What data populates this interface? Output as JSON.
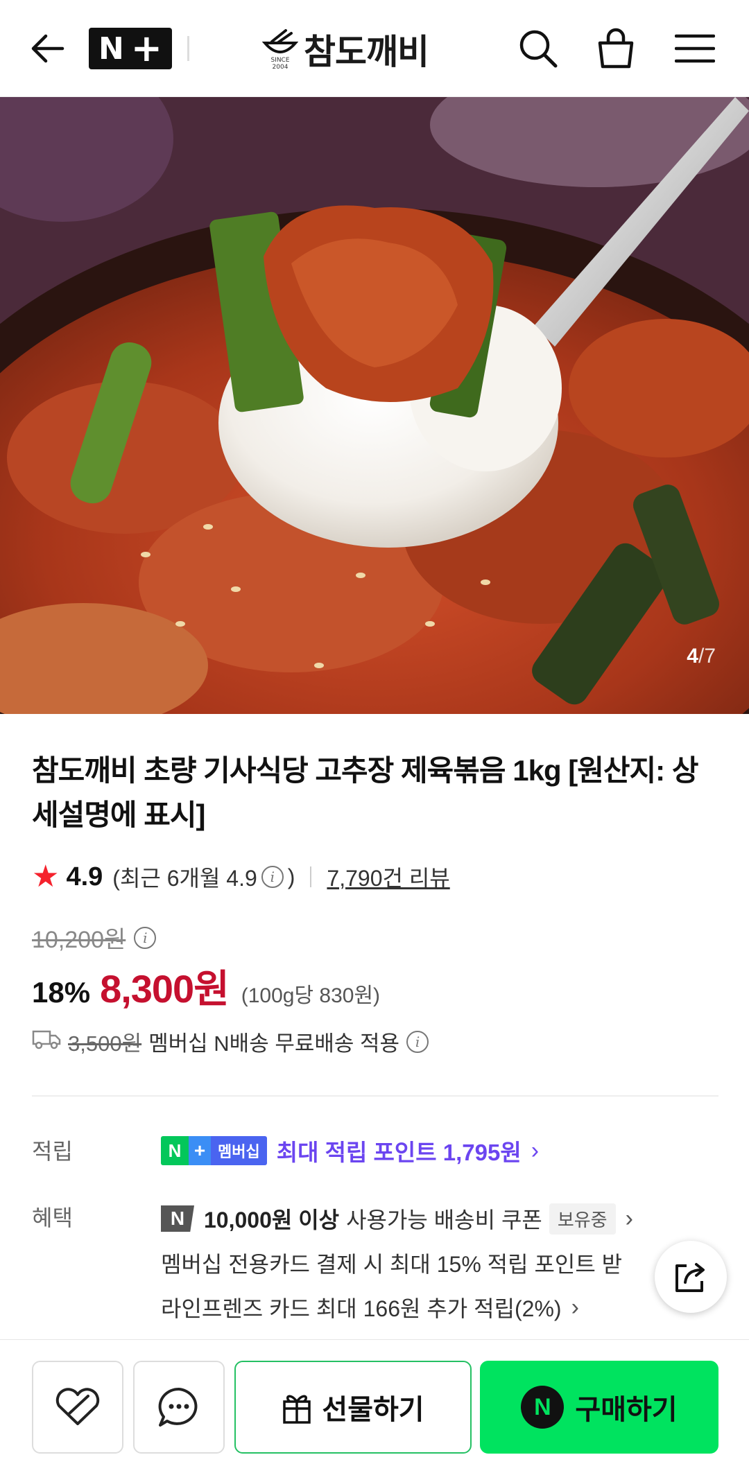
{
  "header": {
    "badge_n": "N",
    "badge_plus": "+",
    "brand_name": "참도깨비",
    "brand_since": "SINCE 2004"
  },
  "gallery": {
    "current": "4",
    "separator": "/",
    "total": "7"
  },
  "product": {
    "title": "참도깨비 초량 기사식당 고추장 제육볶음 1kg [원산지: 상세설명에 표시]",
    "rating": "4.9",
    "rating_recent": "(최근 6개월 4.9",
    "rating_recent_close": ")",
    "review_count": "7,790건 리뷰",
    "original_price": "10,200원",
    "discount_rate": "18%",
    "sale_price": "8,300원",
    "unit_price": "(100g당 830원)",
    "shipping_original": "3,500원",
    "shipping_text": "멤버십 N배송 무료배송 적용"
  },
  "earn": {
    "label": "적립",
    "badge_n": "N",
    "badge_plus": "+",
    "badge_text": "멤버십",
    "text": "최대 적립 포인트 1,795원"
  },
  "benefit": {
    "label": "혜택",
    "coupon_mark": "N",
    "coupon_amount": "10,000원 이상",
    "coupon_text": "사용가능 배송비 쿠폰",
    "coupon_badge": "보유중",
    "line2": "멤버십 전용카드 결제 시 최대 15% 적립 포인트 받",
    "line3": "라인프렌즈 카드 최대 166원 추가 적립(2%)"
  },
  "bottom": {
    "gift_label": "선물하기",
    "buy_mark": "N",
    "buy_label": "구매하기"
  },
  "colors": {
    "price_red": "#c5102f",
    "member_purple": "#6b45f0",
    "buy_green": "#00e35f",
    "star_red": "#f5222d"
  }
}
